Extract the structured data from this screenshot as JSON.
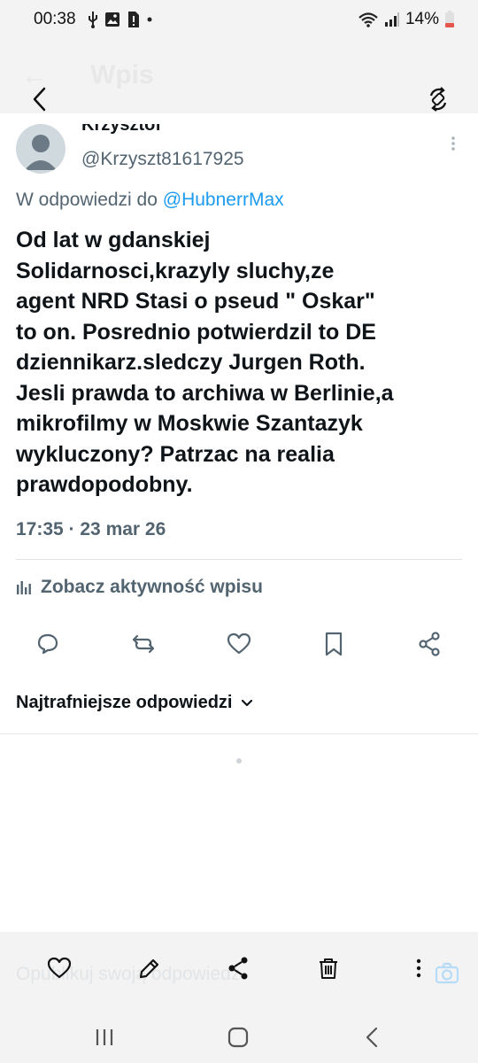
{
  "status_bar": {
    "time": "00:38",
    "battery": "14%"
  },
  "app_bar": {
    "title": "Wpis"
  },
  "tweet": {
    "author_name": "Krzysztof",
    "author_handle": "@Krzyszt81617925",
    "reply_prefix": "W odpowiedzi do ",
    "reply_handle": "@HubnerrMax",
    "text_lines": [
      "Od lat w gdanskiej",
      "Solidarnosci,krazyly sluchy,ze",
      "agent NRD Stasi o pseud \" Oskar\"",
      "to on. Posrednio potwierdzil to DE",
      "dziennikarz.sledczy Jurgen Roth.",
      "Jesli prawda to archiwa w Berlinie,a",
      "mikrofilmy w Moskwie Szantazyk",
      "wykluczony? Patrzac na realia",
      "prawdopodobny."
    ],
    "meta": "17:35 · 23 mar 26",
    "activity_label": "Zobacz aktywność wpisu"
  },
  "replies": {
    "sort_label": "Najtrafniejsze odpowiedzi"
  },
  "composer": {
    "placeholder": "Opublikuj swoją odpowiedź"
  },
  "colors": {
    "link": "#1d9bf0",
    "secondary": "#536471",
    "text": "#0f1419",
    "chrome": "#f3f3f3"
  }
}
